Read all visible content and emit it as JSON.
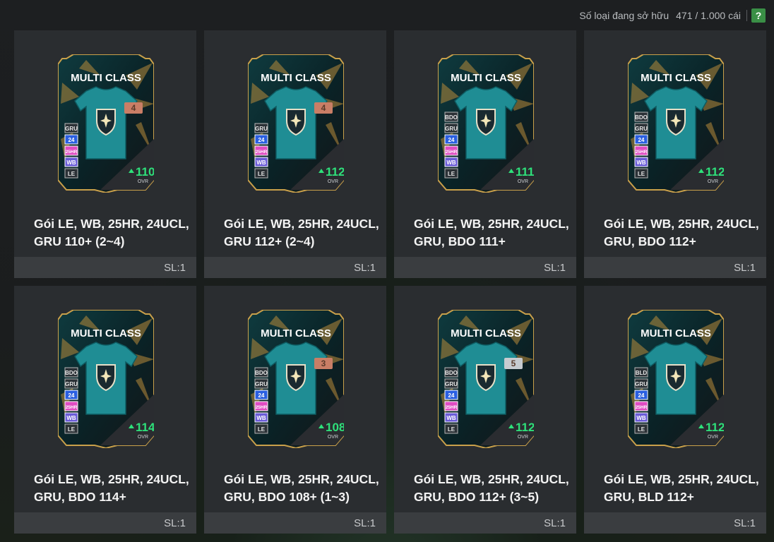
{
  "header": {
    "owned_label": "Số loại đang sở hữu",
    "owned_count": "471 / 1.000 cái",
    "help_label": "?"
  },
  "packs": [
    {
      "title": "Gói LE, WB, 25HR, 24UCL,\nGRU 110+ (2~4)",
      "qty": "SL:1",
      "card_label": "MULTI CLASS",
      "ovr": "110",
      "ovr_label": "OVR",
      "badge": "4",
      "badge_color": "#c97e66",
      "classes": [
        "GRU",
        "24",
        "25HR",
        "WB",
        "LE"
      ]
    },
    {
      "title": "Gói LE, WB, 25HR, 24UCL,\nGRU 112+ (2~4)",
      "qty": "SL:1",
      "card_label": "MULTI CLASS",
      "ovr": "112",
      "ovr_label": "OVR",
      "badge": "4",
      "badge_color": "#c97e66",
      "classes": [
        "GRU",
        "24",
        "25HR",
        "WB",
        "LE"
      ]
    },
    {
      "title": "Gói LE, WB, 25HR, 24UCL,\nGRU, BDO 111+",
      "qty": "SL:1",
      "card_label": "MULTI CLASS",
      "ovr": "111",
      "ovr_label": "OVR",
      "badge": "",
      "badge_color": "",
      "classes": [
        "BDO",
        "GRU",
        "24",
        "25HR",
        "WB",
        "LE"
      ]
    },
    {
      "title": "Gói LE, WB, 25HR, 24UCL,\nGRU, BDO 112+",
      "qty": "SL:1",
      "card_label": "MULTI CLASS",
      "ovr": "112",
      "ovr_label": "OVR",
      "badge": "",
      "badge_color": "",
      "classes": [
        "BDO",
        "GRU",
        "24",
        "25HR",
        "WB",
        "LE"
      ]
    },
    {
      "title": "Gói LE, WB, 25HR, 24UCL,\nGRU, BDO 114+",
      "qty": "SL:1",
      "card_label": "MULTI CLASS",
      "ovr": "114",
      "ovr_label": "OVR",
      "badge": "",
      "badge_color": "",
      "classes": [
        "BDO",
        "GRU",
        "24",
        "25HR",
        "WB",
        "LE"
      ]
    },
    {
      "title": "Gói LE, WB, 25HR, 24UCL,\nGRU, BDO 108+ (1~3)",
      "qty": "SL:1",
      "card_label": "MULTI CLASS",
      "ovr": "108",
      "ovr_label": "OVR",
      "badge": "3",
      "badge_color": "#c97e66",
      "classes": [
        "BDO",
        "GRU",
        "24",
        "25HR",
        "WB",
        "LE"
      ]
    },
    {
      "title": "Gói LE, WB, 25HR, 24UCL,\nGRU, BDO 112+ (3~5)",
      "qty": "SL:1",
      "card_label": "MULTI CLASS",
      "ovr": "112",
      "ovr_label": "OVR",
      "badge": "5",
      "badge_color": "#c7cbd0",
      "classes": [
        "BDO",
        "GRU",
        "24",
        "25HR",
        "WB",
        "LE"
      ]
    },
    {
      "title": "Gói LE, WB, 25HR, 24UCL,\nGRU, BLD 112+",
      "qty": "SL:1",
      "card_label": "MULTI CLASS",
      "ovr": "112",
      "ovr_label": "OVR",
      "badge": "",
      "badge_color": "",
      "classes": [
        "BLD",
        "GRU",
        "24",
        "25HR",
        "WB",
        "LE"
      ]
    }
  ],
  "colors": {
    "ovr_green": "#2ee07a",
    "class_gray": "#b8b8b8",
    "class_24": "#2a5fe0",
    "class_25hr": "#e04bc2",
    "class_wb": "#6a5bd8",
    "accent_green": "#3a8f46"
  }
}
